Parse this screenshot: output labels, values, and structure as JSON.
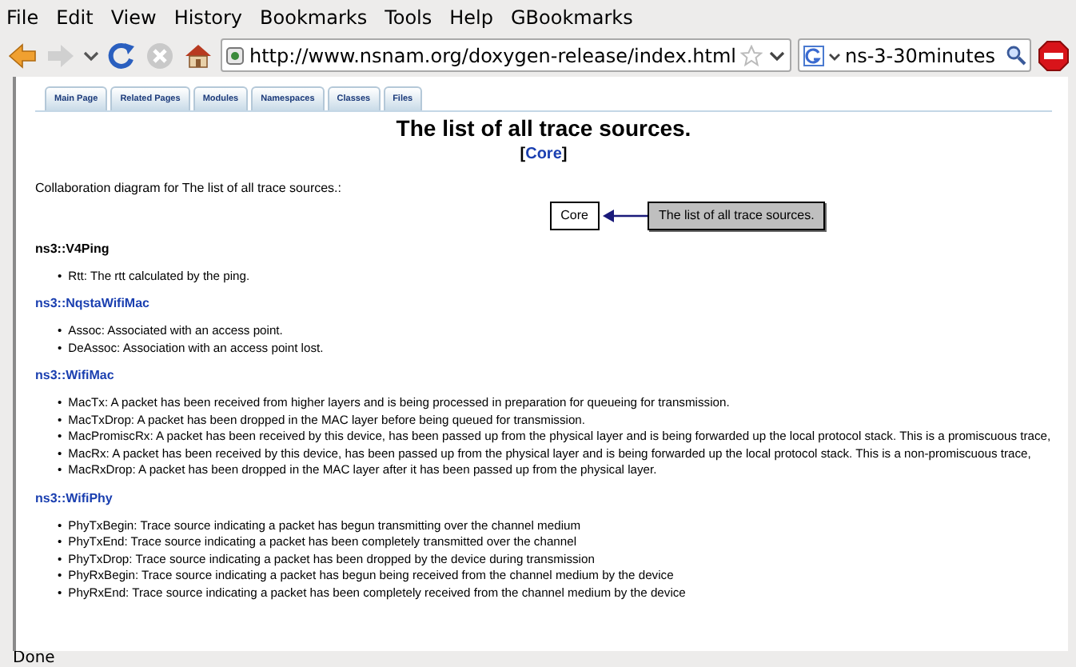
{
  "menu": [
    {
      "label": "File"
    },
    {
      "label": "Edit"
    },
    {
      "label": "View"
    },
    {
      "label": "History"
    },
    {
      "label": "Bookmarks"
    },
    {
      "label": "Tools"
    },
    {
      "label": "Help"
    },
    {
      "label": "GBookmarks"
    }
  ],
  "toolbar": {
    "back_disabled": false,
    "forward_disabled": true,
    "url": "http://www.nsnam.org/doxygen-release/index.html",
    "search": "ns-3-30minutes"
  },
  "tabs": [
    "Main Page",
    "Related Pages",
    "Modules",
    "Namespaces",
    "Classes",
    "Files"
  ],
  "page": {
    "title": "The list of all trace sources.",
    "module_link": "Core",
    "bracket_open": "[",
    "bracket_close": "]",
    "bullet": "•",
    "intro": "Collaboration diagram for The list of all trace sources.:",
    "diagram": {
      "target": "Core",
      "source": "The list of all trace sources."
    },
    "sections": [
      {
        "title": "ns3::V4Ping",
        "link": false,
        "items": [
          "Rtt: The rtt calculated by the ping."
        ]
      },
      {
        "title": "ns3::NqstaWifiMac",
        "link": true,
        "items": [
          "Assoc: Associated with an access point.",
          "DeAssoc: Association with an access point lost."
        ]
      },
      {
        "title": "ns3::WifiMac",
        "link": true,
        "items": [
          "MacTx: A packet has been received from higher layers and is being processed in preparation for queueing for transmission.",
          "MacTxDrop: A packet has been dropped in the MAC layer before being queued for transmission.",
          "MacPromiscRx: A packet has been received by this device, has been passed up from the physical layer and is being forwarded up the local protocol stack. This is a promiscuous trace,",
          "MacRx: A packet has been received by this device, has been passed up from the physical layer and is being forwarded up the local protocol stack. This is a non-promiscuous trace,",
          "MacRxDrop: A packet has been dropped in the MAC layer after it has been passed up from the physical layer."
        ]
      },
      {
        "title": "ns3::WifiPhy",
        "link": true,
        "items": [
          "PhyTxBegin: Trace source indicating a packet has begun transmitting over the channel medium",
          "PhyTxEnd: Trace source indicating a packet has been completely transmitted over the channel",
          "PhyTxDrop: Trace source indicating a packet has been dropped by the device during transmission",
          "PhyRxBegin: Trace source indicating a packet has begun being received from the channel medium by the device",
          "PhyRxEnd: Trace source indicating a packet has been completely received from the channel medium by the device"
        ]
      }
    ]
  },
  "status_bar": "Done"
}
